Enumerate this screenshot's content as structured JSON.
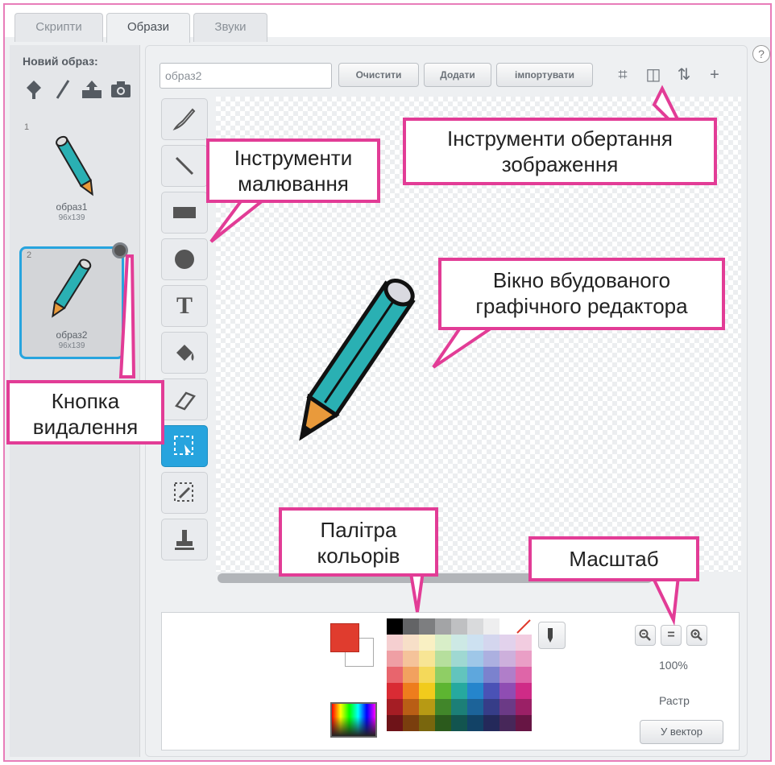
{
  "tabs": [
    {
      "label": "Скрипти"
    },
    {
      "label": "Образи"
    },
    {
      "label": "Звуки"
    }
  ],
  "sidebar": {
    "new_costume_label": "Новий образ:",
    "new_costume_icons": [
      "library-icon",
      "paint-brush-icon",
      "upload-icon",
      "camera-icon"
    ],
    "costumes": [
      {
        "index": "1",
        "name": "образ1",
        "size": "96x139",
        "selected": false
      },
      {
        "index": "2",
        "name": "образ2",
        "size": "96x139",
        "selected": true
      }
    ]
  },
  "editor": {
    "name_value": "образ2",
    "buttons": {
      "clear": "Очистити",
      "add": "Додати",
      "import": "імпортувати"
    },
    "rotation_tools": [
      "crop-icon",
      "flip-horizontal-icon",
      "flip-vertical-icon",
      "set-center-icon"
    ],
    "drawing_tools": [
      "brush-icon",
      "line-icon",
      "rectangle-icon",
      "ellipse-icon",
      "text-icon",
      "fill-icon",
      "eraser-icon",
      "select-icon",
      "select-remove-background-icon",
      "stamp-icon"
    ],
    "active_tool": "select-icon"
  },
  "palette": {
    "primary_color": "#e03c2e",
    "secondary_color": "#ffffff",
    "colors": [
      "#000000",
      "#636466",
      "#7d7e80",
      "#a3a4a6",
      "#bfc0c2",
      "#d9dadc",
      "#eeeeef",
      "#ffffff",
      "none",
      "#f5cfd0",
      "#f7dfc8",
      "#f9f0c3",
      "#d8eec8",
      "#cde9e5",
      "#cde1f1",
      "#d4d6ee",
      "#e2d2ec",
      "#f2cce0",
      "#ef9fa4",
      "#f5c39a",
      "#f7e595",
      "#b6df9d",
      "#9fd8d2",
      "#9fc7e8",
      "#acb0e0",
      "#cdb0dc",
      "#ea9fc6",
      "#e8656d",
      "#f2a15f",
      "#f4d95a",
      "#8fce65",
      "#62c4bd",
      "#5ea7dd",
      "#7b82ce",
      "#b07ec9",
      "#df65a8",
      "#d92b34",
      "#ee7d1d",
      "#f1cb1c",
      "#5db531",
      "#26a99f",
      "#2585cc",
      "#4a52b6",
      "#8f4db3",
      "#cf2b87",
      "#a51d24",
      "#b95e15",
      "#b79a14",
      "#41862a",
      "#1c7f77",
      "#1c6399",
      "#363d88",
      "#6b3a86",
      "#9b2066",
      "#6e1318",
      "#7a3e0e",
      "#79660d",
      "#2b5a1c",
      "#12544f",
      "#124266",
      "#24295a",
      "#472759",
      "#671544"
    ]
  },
  "zoom": {
    "value": "100%"
  },
  "mode": {
    "label": "Растр",
    "convert_button": "У вектор"
  },
  "annotations": {
    "drawing_tools": "Інструменти малювання",
    "rotation_tools": "Інструменти обертання зображення",
    "editor_window": "Вікно вбудованого графічного редактора",
    "delete_button": "Кнопка видалення",
    "palette": "Палітра кольорів",
    "zoom": "Масштаб"
  }
}
